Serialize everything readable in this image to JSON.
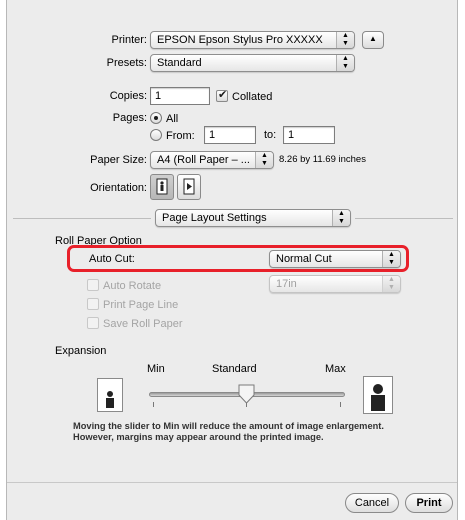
{
  "printer": {
    "label": "Printer:",
    "value": "EPSON Epson Stylus Pro XXXXX"
  },
  "presets": {
    "label": "Presets:",
    "value": "Standard"
  },
  "copies": {
    "label": "Copies:",
    "value": "1",
    "collated_label": "Collated",
    "collated_checked": true
  },
  "pages": {
    "label": "Pages:",
    "all_label": "All",
    "from_label": "From:",
    "from_value": "1",
    "to_label": "to:",
    "to_value": "1"
  },
  "paper_size": {
    "label": "Paper Size:",
    "value": "A4 (Roll Paper – ...",
    "dimensions": "8.26 by 11.69 inches"
  },
  "orientation": {
    "label": "Orientation:"
  },
  "panel": {
    "value": "Page Layout Settings"
  },
  "roll_paper": {
    "title": "Roll Paper Option",
    "auto_cut_label": "Auto Cut:",
    "auto_cut_value": "Normal Cut",
    "auto_rotate_label": "Auto Rotate",
    "auto_rotate_value": "17in",
    "print_page_line_label": "Print Page Line",
    "save_roll_paper_label": "Save Roll Paper"
  },
  "expansion": {
    "title": "Expansion",
    "min_label": "Min",
    "standard_label": "Standard",
    "max_label": "Max",
    "slider_level": "Standard",
    "note_line1": "Moving the slider to Min will reduce the amount of image enlargement.",
    "note_line2": "However, margins may appear around the printed image."
  },
  "buttons": {
    "cancel": "Cancel",
    "print": "Print"
  },
  "colors": {
    "highlight": "#e8202a"
  }
}
